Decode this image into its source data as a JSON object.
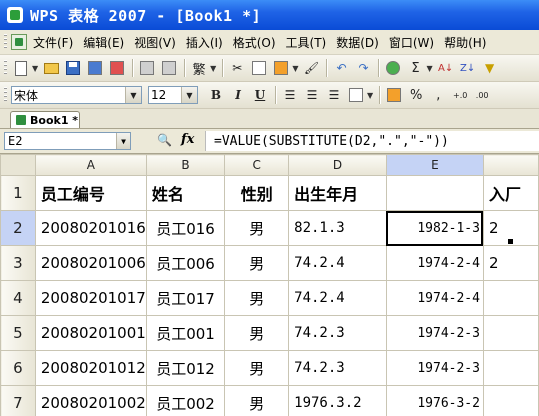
{
  "window": {
    "title": "WPS 表格 2007 - [Book1 *]"
  },
  "menu": {
    "items": [
      "文件(F)",
      "编辑(E)",
      "视图(V)",
      "插入(I)",
      "格式(O)",
      "工具(T)",
      "数据(D)",
      "窗口(W)",
      "帮助(H)"
    ]
  },
  "toolbar": {
    "traditional_label": "繁",
    "sigma_label": "Σ",
    "font_name": "宋体",
    "font_size": "12",
    "bold_label": "B",
    "italic_label": "I",
    "underline_label": "U",
    "percent_label": "%",
    "comma_label": "‚",
    "inc_decimal_label": "+.0",
    "dec_decimal_label": ".00"
  },
  "tabs": [
    {
      "label": "Book1 *"
    }
  ],
  "formula_bar": {
    "name_box": "E2",
    "fx_label": "fx",
    "formula": "=VALUE(SUBSTITUTE(D2,\".\",\"-\"))"
  },
  "sheet": {
    "columns": [
      "A",
      "B",
      "C",
      "D",
      "E",
      ""
    ],
    "rows": [
      {
        "num": "1",
        "a": "员工编号",
        "b": "姓名",
        "c": "性别",
        "d": "出生年月",
        "e": "",
        "f": "入厂"
      },
      {
        "num": "2",
        "a": "20080201016",
        "b": "员工016",
        "c": "男",
        "d": "82.1.3",
        "e": "1982-1-3",
        "f": "2"
      },
      {
        "num": "3",
        "a": "20080201006",
        "b": "员工006",
        "c": "男",
        "d": "74.2.4",
        "e": "1974-2-4",
        "f": "2"
      },
      {
        "num": "4",
        "a": "20080201017",
        "b": "员工017",
        "c": "男",
        "d": "74.2.4",
        "e": "1974-2-4",
        "f": ""
      },
      {
        "num": "5",
        "a": "20080201001",
        "b": "员工001",
        "c": "男",
        "d": "74.2.3",
        "e": "1974-2-3",
        "f": ""
      },
      {
        "num": "6",
        "a": "20080201012",
        "b": "员工012",
        "c": "男",
        "d": "74.2.3",
        "e": "1974-2-3",
        "f": ""
      },
      {
        "num": "7",
        "a": "20080201002",
        "b": "员工002",
        "c": "男",
        "d": "1976.3.2",
        "e": "1976-3-2",
        "f": ""
      }
    ]
  },
  "colors": {
    "titlebar": "#0a4bd6",
    "chrome": "#ece9d8",
    "gridline": "#c9c5b3",
    "active_header": "#c5d3f5"
  }
}
